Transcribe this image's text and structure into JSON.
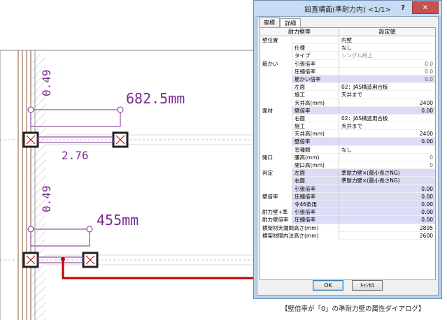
{
  "drawing": {
    "dim_top_length": "682.5mm",
    "dim_bottom_length": "455mm",
    "dim_vertical_top": "0.49",
    "dim_vertical_bottom": "0.49",
    "dim_wall": "2.76"
  },
  "dialog": {
    "title": "鉛直構面(準耐力内) <1/1>",
    "help_label": "?",
    "close_label": "✕",
    "tabs": [
      "座標",
      "詳細"
    ],
    "col_header_attr": "耐力壁等",
    "col_header_value": "設定値",
    "rows": [
      {
        "c1": "壁位置",
        "c2": "",
        "c3": "内壁",
        "num": false,
        "gray": false,
        "hl": false
      },
      {
        "c1": "",
        "c2": "仕様",
        "c3": "なし",
        "num": false,
        "gray": false,
        "hl": false
      },
      {
        "c1": "",
        "c2": "タイプ",
        "c3": "シングル終上",
        "num": false,
        "gray": true,
        "hl": false
      },
      {
        "c1": "筋かい",
        "c2": "引張倍率",
        "c3": "0.0",
        "num": true,
        "gray": true,
        "hl": false
      },
      {
        "c1": "",
        "c2": "圧縮倍率",
        "c3": "0.0",
        "num": true,
        "gray": true,
        "hl": false
      },
      {
        "c1": "",
        "c2": "筋かい倍率",
        "c3": "0.0",
        "num": true,
        "gray": true,
        "hl": true
      },
      {
        "c1": "",
        "c2": "左面",
        "c3": "02：JAS構造用合板",
        "num": false,
        "gray": false,
        "hl": false
      },
      {
        "c1": "",
        "c2": "施工",
        "c3": "天井まで",
        "num": false,
        "gray": false,
        "hl": false
      },
      {
        "c1": "",
        "c2": "天井高(mm)",
        "c3": "2400",
        "num": true,
        "gray": false,
        "hl": false
      },
      {
        "c1": "面材",
        "c2": "壁倍率",
        "c3": "0.00",
        "num": true,
        "gray": false,
        "hl": true
      },
      {
        "c1": "",
        "c2": "右面",
        "c3": "02：JAS構造用合板",
        "num": false,
        "gray": false,
        "hl": false
      },
      {
        "c1": "",
        "c2": "施工",
        "c3": "天井まで",
        "num": false,
        "gray": false,
        "hl": false
      },
      {
        "c1": "",
        "c2": "天井高(mm)",
        "c3": "2400",
        "num": true,
        "gray": false,
        "hl": false
      },
      {
        "c1": "",
        "c2": "壁倍率",
        "c3": "0.00",
        "num": true,
        "gray": false,
        "hl": true
      },
      {
        "c1": "",
        "c2": "窓種類",
        "c3": "なし",
        "num": false,
        "gray": false,
        "hl": false
      },
      {
        "c1": "開口",
        "c2": "腰高(mm)",
        "c3": "0",
        "num": true,
        "gray": true,
        "hl": false
      },
      {
        "c1": "",
        "c2": "開口高(mm)",
        "c3": "0",
        "num": true,
        "gray": true,
        "hl": false
      },
      {
        "c1": "判定",
        "c2": "左面",
        "c3": "準耐力壁×(最小長さNG)",
        "num": false,
        "gray": false,
        "hl": true
      },
      {
        "c1": "",
        "c2": "右面",
        "c3": "準耐力壁×(最小長さNG)",
        "num": false,
        "gray": false,
        "hl": true
      },
      {
        "c1": "",
        "c2": "引張倍率",
        "c3": "0.00",
        "num": true,
        "gray": false,
        "hl": true
      },
      {
        "c1": "壁倍率",
        "c2": "圧縮倍率",
        "c3": "0.00",
        "num": true,
        "gray": false,
        "hl": true
      },
      {
        "c1": "",
        "c2": "令46条用",
        "c3": "0.00",
        "num": true,
        "gray": false,
        "hl": true
      },
      {
        "c1": "耐力壁+準",
        "c2": "引張倍率",
        "c3": "0.00",
        "num": true,
        "gray": false,
        "hl": true
      },
      {
        "c1": "耐力壁倍率",
        "c2": "圧縮倍率",
        "c3": "0.00",
        "num": true,
        "gray": false,
        "hl": true
      },
      {
        "c1": "横架材天端間高さ(mm)",
        "c2": "",
        "c3": "2895",
        "num": true,
        "gray": false,
        "hl": false
      },
      {
        "c1": "横架材間内法高さ(mm)",
        "c2": "",
        "c3": "2600",
        "num": true,
        "gray": false,
        "hl": false
      }
    ],
    "ok_label": "OK",
    "cancel_label": "ｷｬﾝｾﾙ"
  },
  "caption": "【壁倍率が「0」の準耐力壁の属性ダイアログ】",
  "colors": {
    "accent_red": "#c00000",
    "dim_purple": "#7b2a8f"
  }
}
